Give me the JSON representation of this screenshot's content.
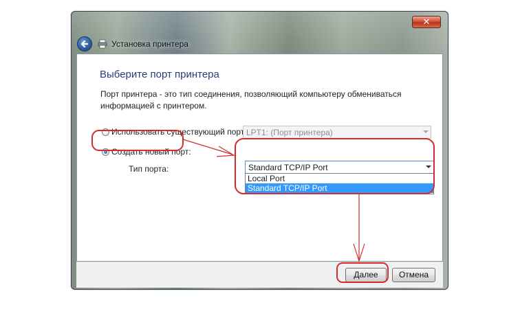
{
  "window": {
    "title": "Установка принтера",
    "close_label": "✕"
  },
  "page": {
    "heading": "Выберите порт принтера",
    "description": "Порт принтера - это тип соединения, позволяющий компьютеру обмениваться информацией с принтером."
  },
  "options": {
    "existing_port": {
      "label": "Использовать существующий порт:",
      "selected": false,
      "select_value": "LPT1: (Порт принтера)"
    },
    "new_port": {
      "label": "Создать новый порт:",
      "selected": true
    },
    "port_type": {
      "label": "Тип порта:",
      "value": "Standard TCP/IP Port",
      "options": [
        "Local Port",
        "Standard TCP/IP Port"
      ],
      "highlighted_option": "Standard TCP/IP Port"
    }
  },
  "buttons": {
    "next": "Далее",
    "cancel": "Отмена"
  },
  "icons": {
    "back": "back-arrow-icon",
    "printer": "printer-icon",
    "close": "close-icon"
  },
  "colors": {
    "annotation": "#d32b2b",
    "selection": "#3399ff",
    "heading": "#1f3f7d"
  }
}
